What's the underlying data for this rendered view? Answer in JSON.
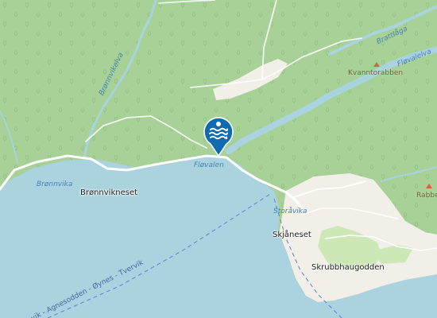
{
  "map": {
    "colors": {
      "forest": "#a7d197",
      "water": "#aad3df",
      "road": "#ffffff",
      "bare_land": "#f2efe9",
      "meadow": "#cde8b6",
      "marker": "#0e6bb0",
      "ferry_route": "#5b7fcf",
      "peak": "#c66a40"
    },
    "places": {
      "bronnvikneset": "Brønnvikneset",
      "skjaneset": "Skjåneset",
      "skrubbhaugodden": "Skrubbhaugodden"
    },
    "water_labels": {
      "bronnvika": "Brønnvika",
      "flovalen": "Fløvalen",
      "storavika": "Storåvika",
      "bronnvikelva": "Brønnvikelva",
      "brattlaga": "Brattlåga",
      "flovalelva": "Fløvalelva"
    },
    "peaks": {
      "kvanntorabben": "Kvanntorabben",
      "rabbe": "Rabbe"
    },
    "ferry_route": {
      "label": "vik - Agnesodden - Øynes - Tvervik"
    },
    "marker": {
      "icon": "swimming-icon"
    }
  }
}
